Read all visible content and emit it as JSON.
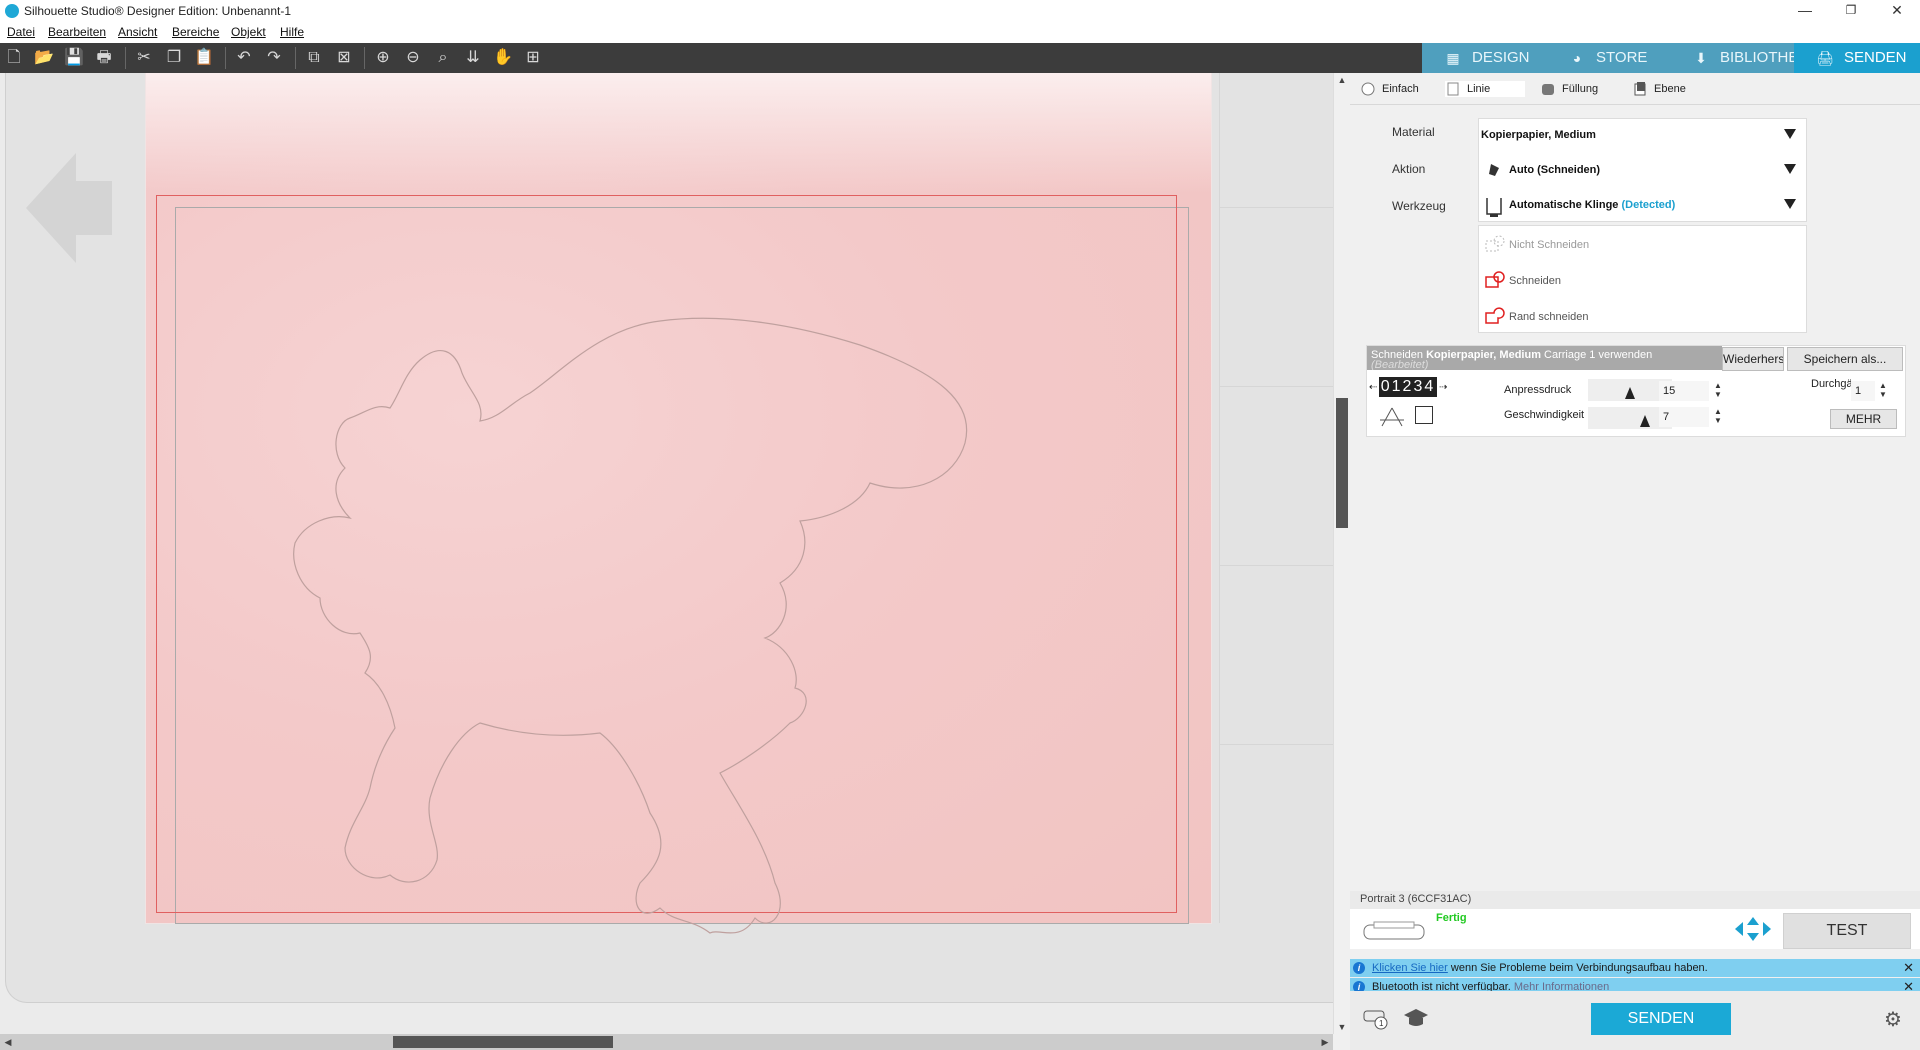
{
  "window": {
    "title": "Silhouette Studio® Designer Edition: Unbenannt-1",
    "minimize": "—",
    "maximize": "❐",
    "close": "✕"
  },
  "menu": [
    "Datei",
    "Bearbeiten",
    "Ansicht",
    "Bereiche",
    "Objekt",
    "Hilfe"
  ],
  "toolbar_icons": [
    "new-file-icon",
    "open-icon",
    "save-icon",
    "print-icon",
    "cut-icon",
    "copy-icon",
    "paste-icon",
    "undo-icon",
    "redo-icon",
    "group-icon",
    "ungroup-icon",
    "zoom-in-icon",
    "zoom-out-icon",
    "zoom-select-icon",
    "fit-page-icon",
    "pan-hand-icon",
    "add-page-icon"
  ],
  "nav_tabs": [
    {
      "label": "DESIGN",
      "icon": "grid-icon"
    },
    {
      "label": "STORE",
      "icon": "store-icon"
    },
    {
      "label": "BIBLIOTHEK",
      "icon": "library-icon"
    },
    {
      "label": "SENDEN",
      "icon": "send-icon"
    }
  ],
  "modes": [
    "Einfach",
    "Linie",
    "Füllung",
    "Ebene"
  ],
  "form": {
    "material_label": "Material",
    "aktion_label": "Aktion",
    "werkzeug_label": "Werkzeug",
    "material_value": "Kopierpapier, Medium",
    "aktion_value": "Auto (Schneiden)",
    "werkzeug_value": "Automatische Klinge",
    "werkzeug_detected": "(Detected)"
  },
  "cut_actions": [
    "Nicht Schneiden",
    "Schneiden",
    "Rand schneiden"
  ],
  "settings": {
    "head_prefix": "Schneiden",
    "head_material": "Kopierpapier, Medium",
    "head_suffix": "Carriage 1 verwenden",
    "head_sub": "(Bearbeitet)",
    "restore_btn": "Wiederherstellen",
    "save_as_btn": "Speichern als...",
    "carriage_digits": "01234",
    "anpressdruck_label": "Anpressdruck",
    "anpressdruck_value": "15",
    "anpressdruck_level": 0.5,
    "geschwindigkeit_label": "Geschwindigkeit",
    "geschwindigkeit_value": "7",
    "geschwindigkeit_level": 0.7,
    "durchgaenge_label": "Durchgänge",
    "durchgaenge_value": "1",
    "mehr_btn": "MEHR"
  },
  "device": {
    "name": "Portrait 3 (6CCF31AC)",
    "status": "Fertig",
    "test_btn": "TEST"
  },
  "notices": [
    {
      "link": "Klicken Sie hier",
      "text": " wenn Sie Probleme beim Verbindungsaufbau haben."
    },
    {
      "text": "Bluetooth ist nicht verfügbar. ",
      "link": "Mehr Informationen"
    }
  ],
  "send_btn": "SENDEN",
  "colors": {
    "accent": "#1ba0cf",
    "toolbar": "#3c3c3c",
    "cut_line": "#e06060",
    "status_ok": "#21c921",
    "notice": "#7fcff0"
  }
}
